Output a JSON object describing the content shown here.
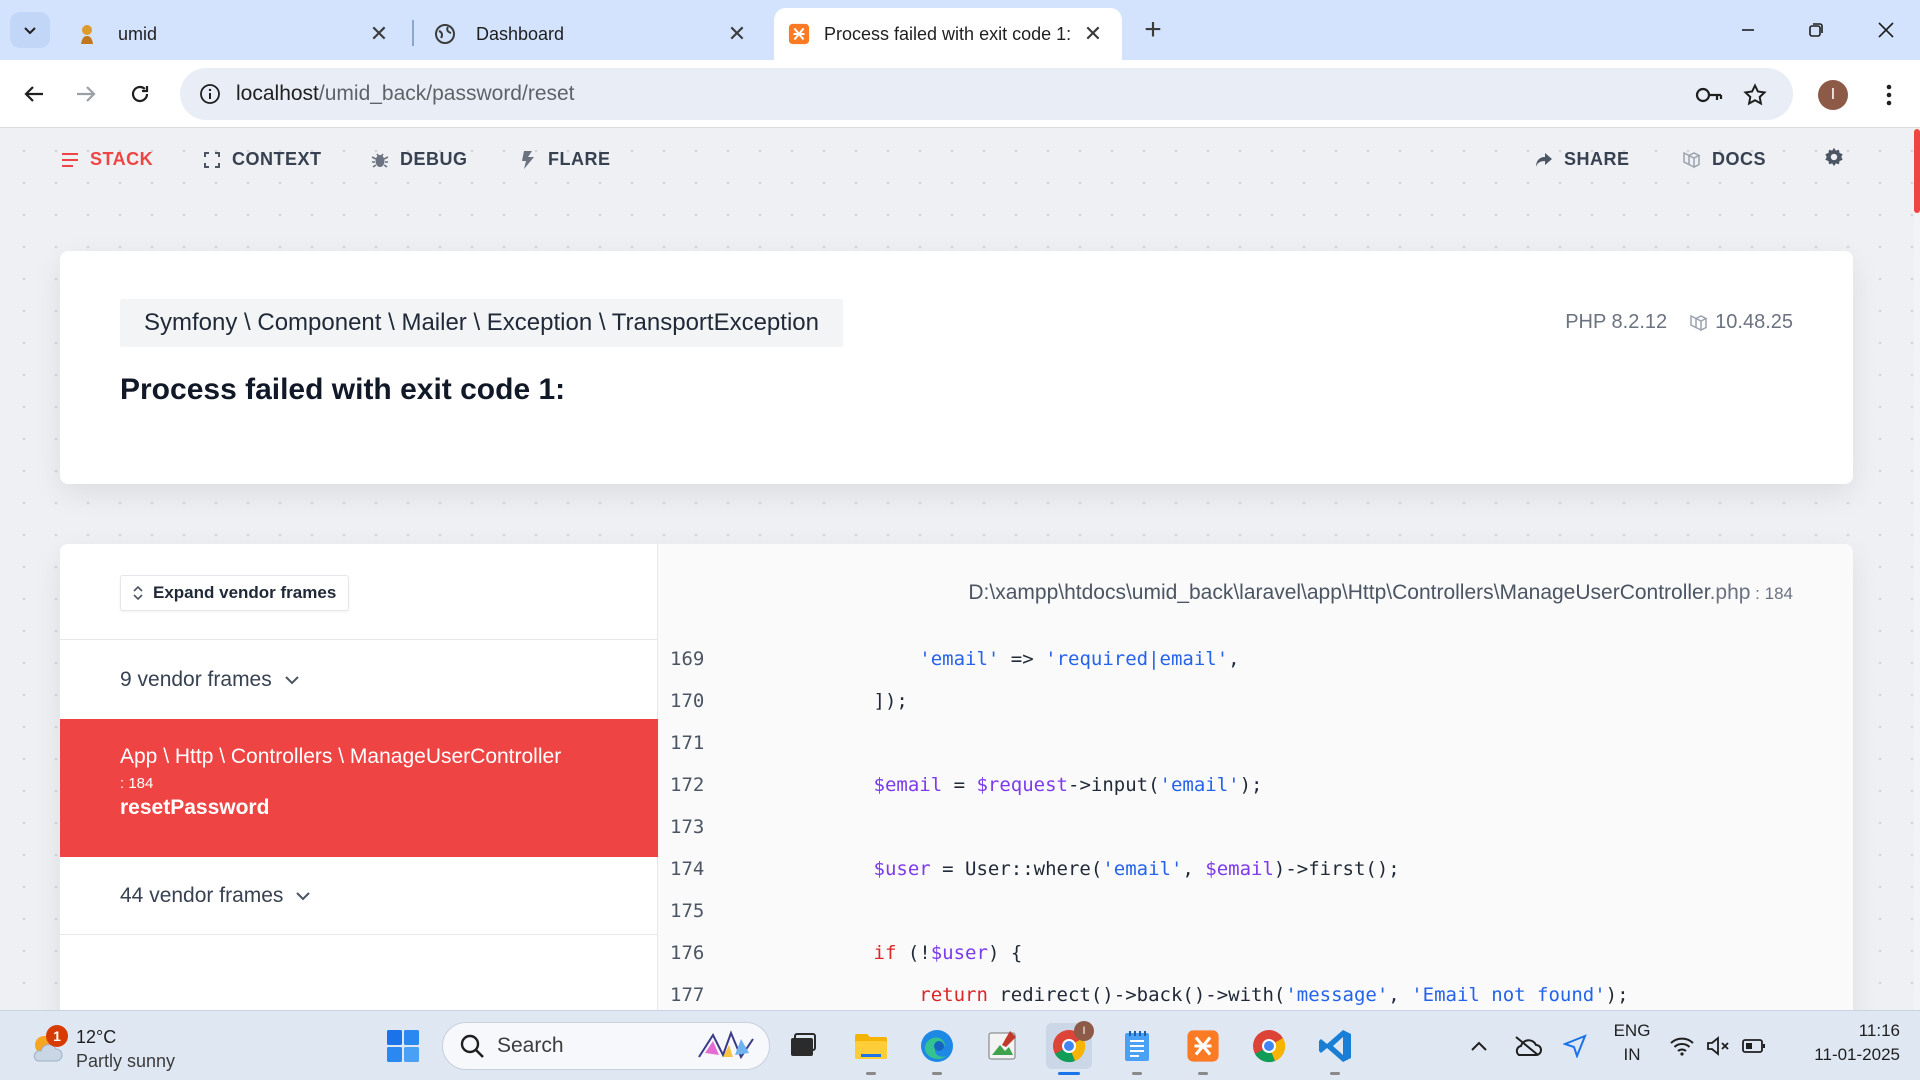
{
  "browser": {
    "tabs": [
      {
        "title": "umid",
        "active": false
      },
      {
        "title": "Dashboard",
        "active": false
      },
      {
        "title": "Process failed with exit code 1:",
        "active": true
      }
    ],
    "url_host": "localhost",
    "url_path": "/umid_back/password/reset",
    "profile_initial": "I"
  },
  "nav": {
    "stack": "STACK",
    "context": "CONTEXT",
    "debug": "DEBUG",
    "flare": "FLARE",
    "share": "SHARE",
    "docs": "DOCS"
  },
  "exception": {
    "class": "Symfony \\ Component \\ Mailer \\ Exception \\ TransportException",
    "message": "Process failed with exit code 1:",
    "php_version": "PHP 8.2.12",
    "laravel_version": "10.48.25"
  },
  "frames": {
    "expand_label": "Expand vendor frames",
    "vendor_group_1": "9 vendor frames",
    "active_class": "App \\ Http \\ Controllers \\ ManageUserController",
    "active_line": ": 184",
    "active_method": "resetPassword",
    "vendor_group_2": "44 vendor frames"
  },
  "file": {
    "path": "D:\\xampp\\htdocs\\umid_back\\laravel\\app\\Http\\Controllers\\ManageUserController",
    "ext": ".php",
    "line": " : 184"
  },
  "code_lines": [
    {
      "no": "169"
    },
    {
      "no": "170"
    },
    {
      "no": "171"
    },
    {
      "no": "172"
    },
    {
      "no": "173"
    },
    {
      "no": "174"
    },
    {
      "no": "175"
    },
    {
      "no": "176"
    },
    {
      "no": "177"
    }
  ],
  "taskbar": {
    "weather_temp": "12°C",
    "weather_desc": "Partly sunny",
    "weather_badge": "1",
    "search_label": "Search",
    "lang_1": "ENG",
    "lang_2": "IN",
    "time": "11:16",
    "date": "11-01-2025"
  },
  "colors": {
    "accent": "#ef4444",
    "tabbar": "#d3e3fd",
    "string": "#2563eb",
    "variable": "#7c3aed",
    "keyword": "#dc2626"
  }
}
